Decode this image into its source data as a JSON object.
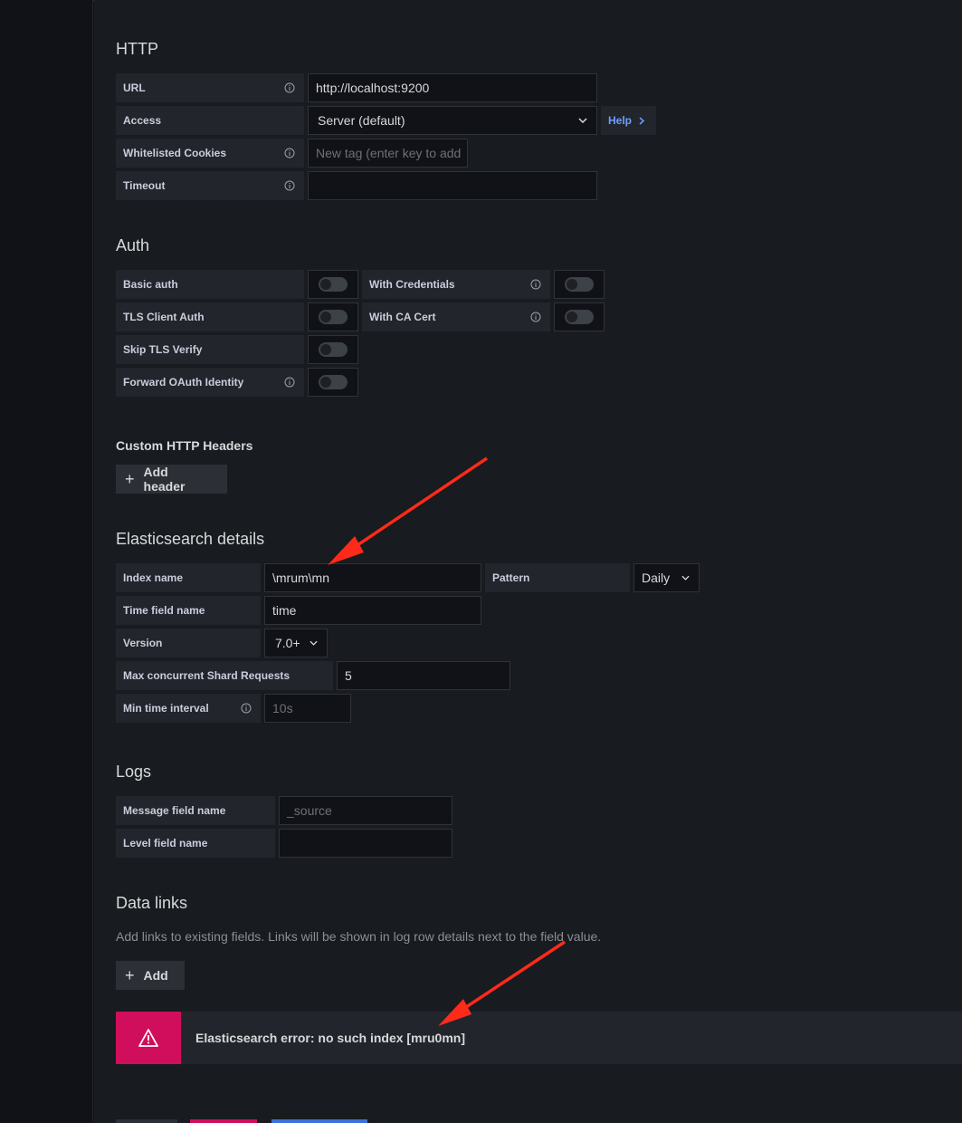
{
  "http": {
    "title": "HTTP",
    "url_label": "URL",
    "url_value": "http://localhost:9200",
    "access_label": "Access",
    "access_value": "Server (default)",
    "help_label": "Help",
    "cookies_label": "Whitelisted Cookies",
    "cookies_placeholder": "New tag (enter key to add",
    "timeout_label": "Timeout",
    "timeout_value": ""
  },
  "auth": {
    "title": "Auth",
    "basic_auth": "Basic auth",
    "with_credentials": "With Credentials",
    "tls_client_auth": "TLS Client Auth",
    "with_ca_cert": "With CA Cert",
    "skip_tls_verify": "Skip TLS Verify",
    "forward_oauth": "Forward OAuth Identity"
  },
  "headers": {
    "title": "Custom HTTP Headers",
    "add_header": "Add header"
  },
  "es": {
    "title": "Elasticsearch details",
    "index_label": "Index name",
    "index_value": "\\mrum\\mn",
    "pattern_label": "Pattern",
    "pattern_value": "Daily",
    "time_field_label": "Time field name",
    "time_field_value": "time",
    "version_label": "Version",
    "version_value": "7.0+",
    "max_shard_label": "Max concurrent Shard Requests",
    "max_shard_value": "5",
    "min_interval_label": "Min time interval",
    "min_interval_placeholder": "10s"
  },
  "logs": {
    "title": "Logs",
    "message_label": "Message field name",
    "message_placeholder": "_source",
    "level_label": "Level field name",
    "level_value": ""
  },
  "data_links": {
    "title": "Data links",
    "description": "Add links to existing fields. Links will be shown in log row details next to the field value.",
    "add": "Add"
  },
  "alert": {
    "message": "Elasticsearch error: no such index [mru0mn]"
  },
  "colors": {
    "background": "#181b1f",
    "accent_link": "#6e9fff",
    "alert": "#d10e5c",
    "annotation_arrow": "#ff2a1a"
  }
}
